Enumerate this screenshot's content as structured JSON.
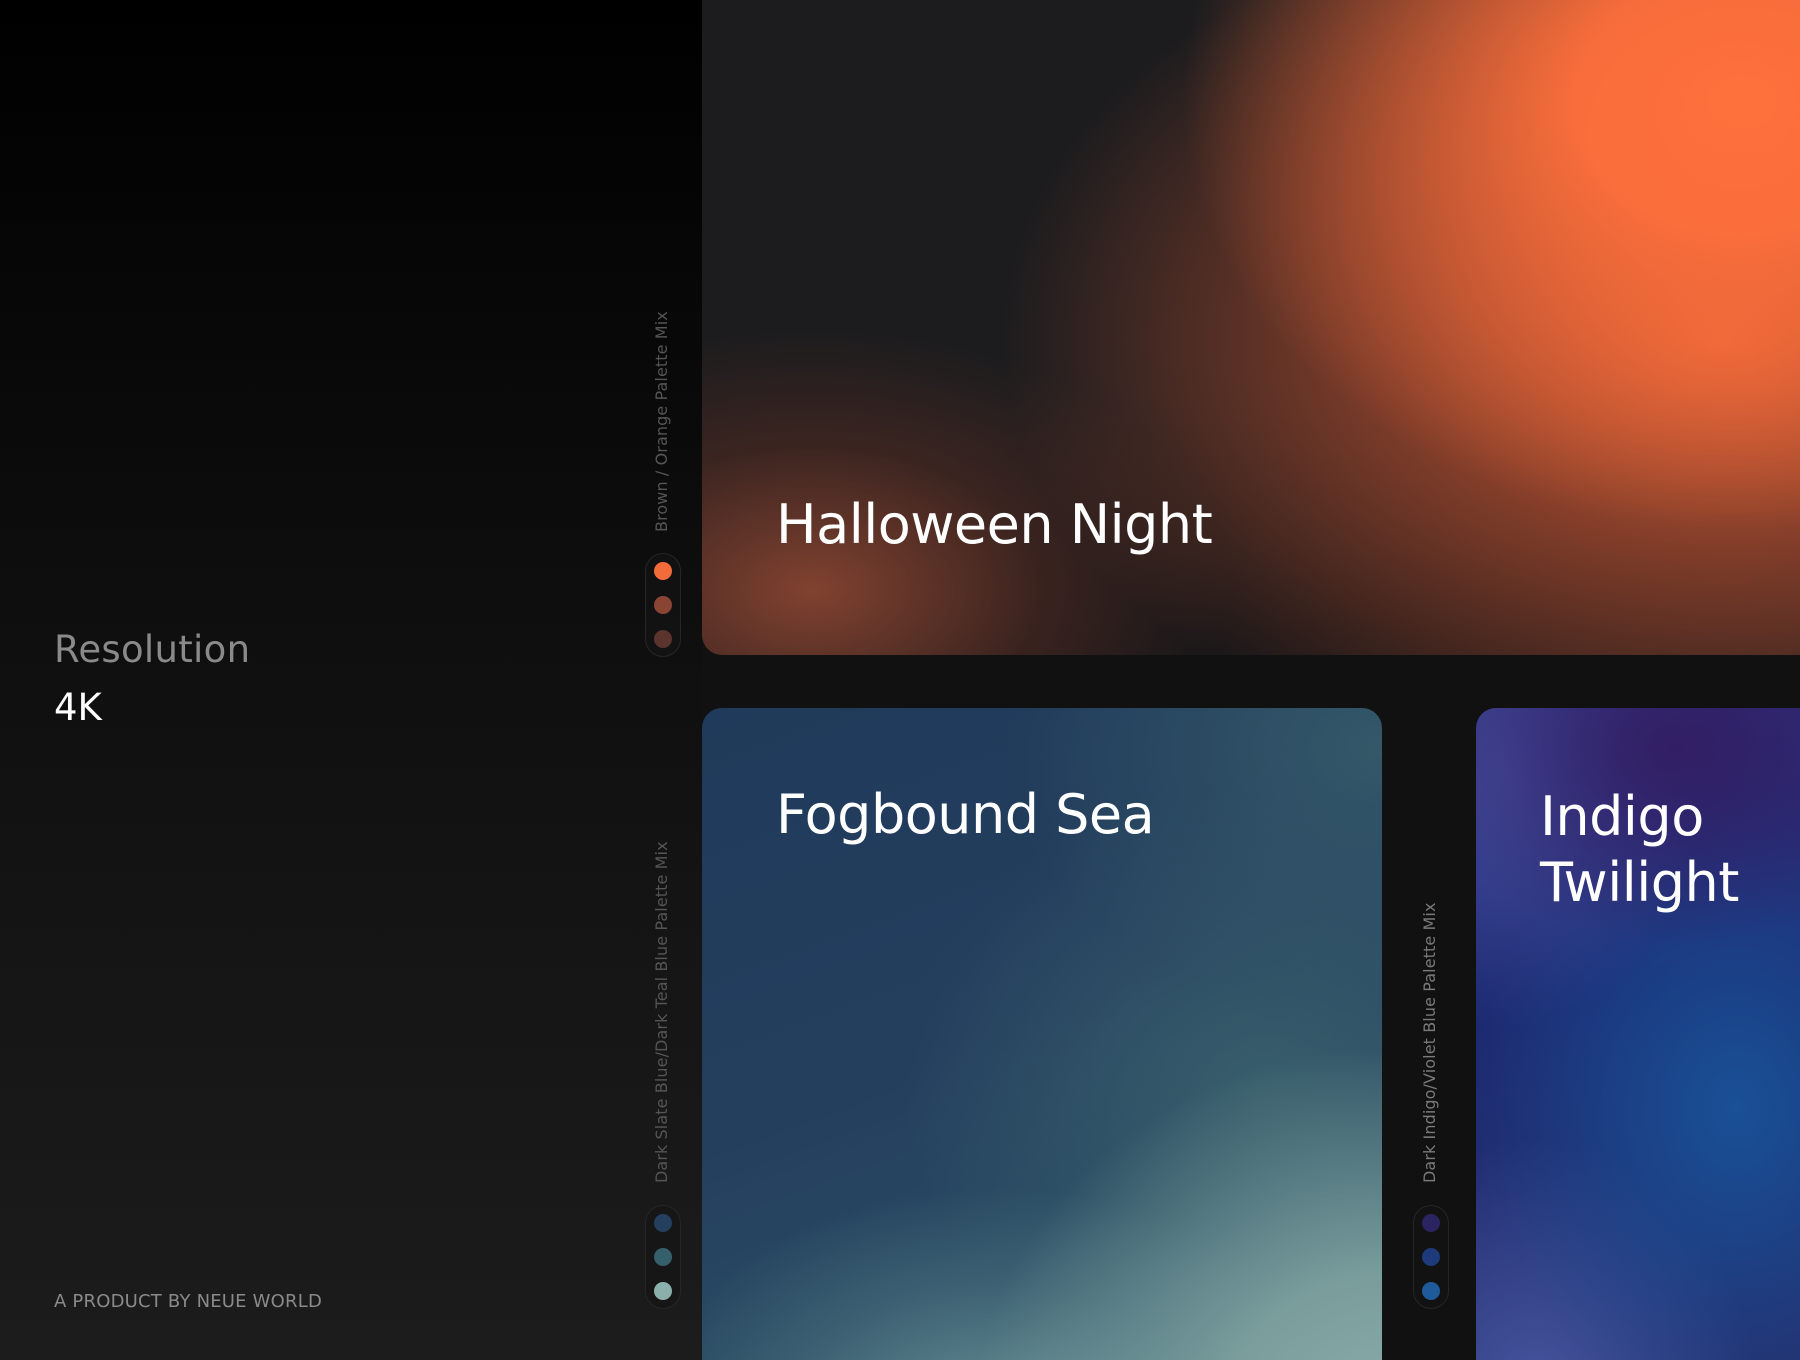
{
  "sidebar": {
    "resolution_label": "Resolution",
    "resolution_value": "4K",
    "credit": "A PRODUCT BY NEUE WORLD"
  },
  "palettes": [
    {
      "title": "Halloween Night",
      "caption": "Brown / Orange Palette Mix",
      "swatches": [
        "#f26b3a",
        "#8a4434",
        "#5a342d"
      ]
    },
    {
      "title": "Fogbound Sea",
      "caption": "Dark Slate Blue/Dark Teal Blue Palette Mix",
      "swatches": [
        "#24405e",
        "#365f6c",
        "#8bb0ab"
      ]
    },
    {
      "title": "Indigo Twilight",
      "caption": "Dark Indigo/Violet Blue Palette Mix",
      "swatches": [
        "#2a2560",
        "#1d3a7a",
        "#1f5a9a"
      ]
    }
  ]
}
